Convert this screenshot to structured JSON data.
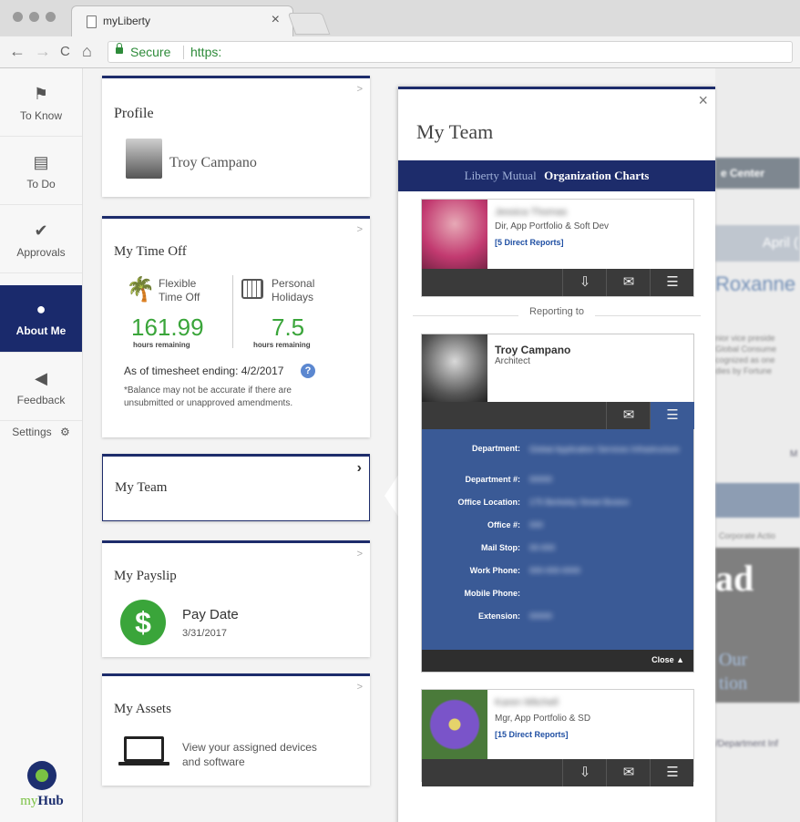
{
  "browser": {
    "tab_title": "myLiberty",
    "tab_close": "×",
    "secure_label": "Secure",
    "url_scheme": "https:",
    "back": "←",
    "forward": "→",
    "reload": "C",
    "home": "⌂"
  },
  "sidebar": {
    "items": [
      {
        "label": "To Know",
        "icon": "flag-icon",
        "glyph": "⚑"
      },
      {
        "label": "To Do",
        "icon": "clipboard-icon",
        "glyph": "▤"
      },
      {
        "label": "Approvals",
        "icon": "check-circle-icon",
        "glyph": "✔"
      },
      {
        "label": "About Me",
        "icon": "person-icon",
        "glyph": "●"
      },
      {
        "label": "Feedback",
        "icon": "megaphone-icon",
        "glyph": "◀"
      }
    ],
    "settings_label": "Settings",
    "settings_glyph": "⚙",
    "logo_my": "my",
    "logo_hub": "Hub"
  },
  "cards": {
    "profile": {
      "title": "Profile",
      "name": "Troy Campano"
    },
    "time_off": {
      "title": "My Time Off",
      "flexible_label_1": "Flexible",
      "flexible_label_2": "Time Off",
      "flexible_value": "161.99",
      "flexible_sub": "hours remaining",
      "personal_label_1": "Personal",
      "personal_label_2": "Holidays",
      "personal_value": "7.5",
      "personal_sub": "hours remaining",
      "as_of": "As of timesheet ending: 4/2/2017",
      "note_1": "*Balance may not be accurate if there are",
      "note_2": "unsubmitted or unapproved amendments."
    },
    "my_team": {
      "title": "My Team",
      "chev": "›"
    },
    "payslip": {
      "title": "My Payslip",
      "pay_label": "Pay Date",
      "pay_date": "3/31/2017",
      "icon_glyph": "$"
    },
    "assets": {
      "title": "My Assets",
      "desc_1": "View your assigned devices",
      "desc_2": "and software"
    }
  },
  "panel": {
    "title": "My Team",
    "close": "×",
    "banner_left": "Liberty Mutual",
    "banner_right": "Organization Charts",
    "manager": {
      "name": "Jessica Thomas",
      "role": "Dir, App Portfolio & Soft Dev",
      "reports": "[5 Direct Reports]"
    },
    "reporting_to": "Reporting to",
    "self": {
      "name": "Troy Campano",
      "role": "Architect",
      "fields": [
        {
          "label": "Department:",
          "value": "Global Application Services Infrastructure"
        },
        {
          "label": "Department #:",
          "value": "00000"
        },
        {
          "label": "Office Location:",
          "value": "175 Berkeley Street Boston"
        },
        {
          "label": "Office #:",
          "value": "000"
        },
        {
          "label": "Mail Stop:",
          "value": "00-000"
        },
        {
          "label": "Work Phone:",
          "value": "000-000-0000"
        },
        {
          "label": "Mobile Phone:",
          "value": ""
        },
        {
          "label": "Extension:",
          "value": "00000"
        }
      ],
      "close_label": "Close ▲"
    },
    "report": {
      "name": "Karen Mitchell",
      "role": "Mgr, App Portfolio & SD",
      "reports": "[15 Direct Reports]"
    }
  },
  "background": {
    "resource_center": "e Center",
    "april": "April (",
    "name": "Roxanne",
    "snippet_1": "nior vice preside",
    "snippet_2": "Global Consume",
    "snippet_3": "cognized as one",
    "snippet_4": "dies by Fortune",
    "more": "M",
    "corporate": "Corporate Actio",
    "big_ad": "ad",
    "our": "Our",
    "tion": "tion",
    "dept_info": "/Department Inf"
  },
  "colors": {
    "navy": "#1d2c6b",
    "green": "#3aa53a",
    "panel_blue": "#3a5a96"
  }
}
